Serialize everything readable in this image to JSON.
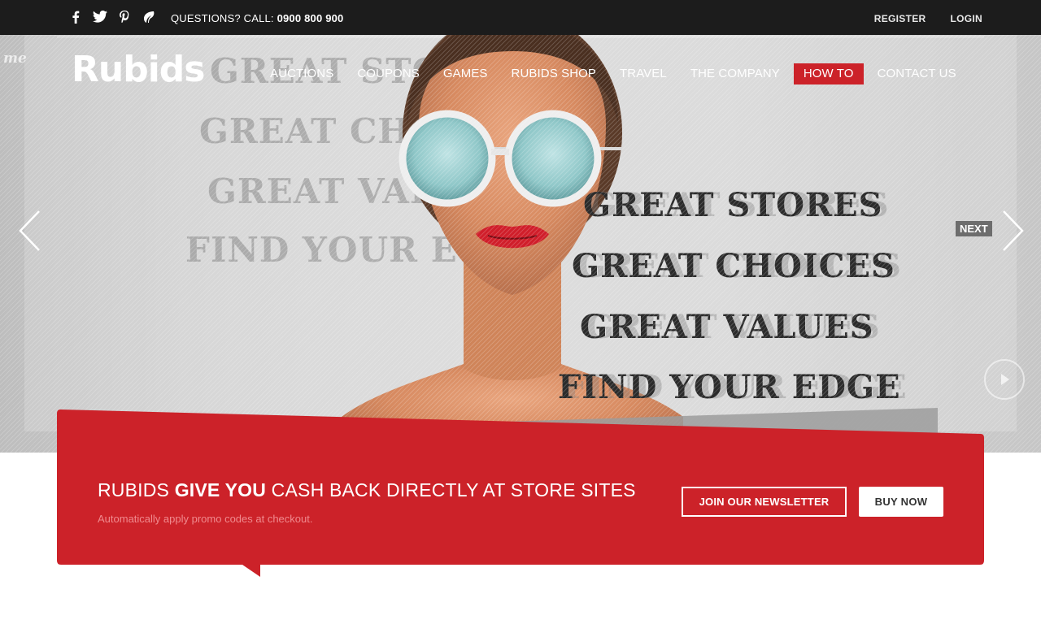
{
  "topbar": {
    "social_icons": [
      "facebook-icon",
      "twitter-icon",
      "pinterest-icon",
      "leaf-icon"
    ],
    "social_glyphs": [
      "f",
      "t",
      "p",
      "e"
    ],
    "phone_prefix": "QUESTIONS? CALL:",
    "phone_number": "0900 800 900",
    "register": "REGISTER",
    "login": "LOGIN"
  },
  "brand": {
    "logo": "Rubids",
    "mark": "me"
  },
  "nav": {
    "items": [
      {
        "label": "AUCTIONS"
      },
      {
        "label": "COUPONS"
      },
      {
        "label": "GAMES"
      },
      {
        "label": "RUBIDS SHOP"
      },
      {
        "label": "TRAVEL"
      },
      {
        "label": "THE COMPANY"
      },
      {
        "label": "HOW TO"
      },
      {
        "label": "CONTACT US"
      }
    ],
    "active_index": 6,
    "active_color": "#cc2229"
  },
  "hero": {
    "headlines": [
      "GREAT STORES",
      "GREAT CHOICES",
      "GREAT VALUES",
      "FIND YOUR EDGE"
    ],
    "ghost_lines": [
      "GREAT STO",
      "GREAT CHO",
      "GREAT VAL",
      "FIND YOUR E"
    ],
    "next_label": "NEXT"
  },
  "banner": {
    "title_pre": "RUBIDS ",
    "title_bold": "GIVE YOU",
    "title_post": " CASH BACK DIRECTLY AT STORE SITES",
    "subtitle": "Automatically apply promo codes at checkout.",
    "newsletter_button": "JOIN OUR NEWSLETTER",
    "buy_button": "BUY NOW",
    "color": "#cc2229"
  }
}
